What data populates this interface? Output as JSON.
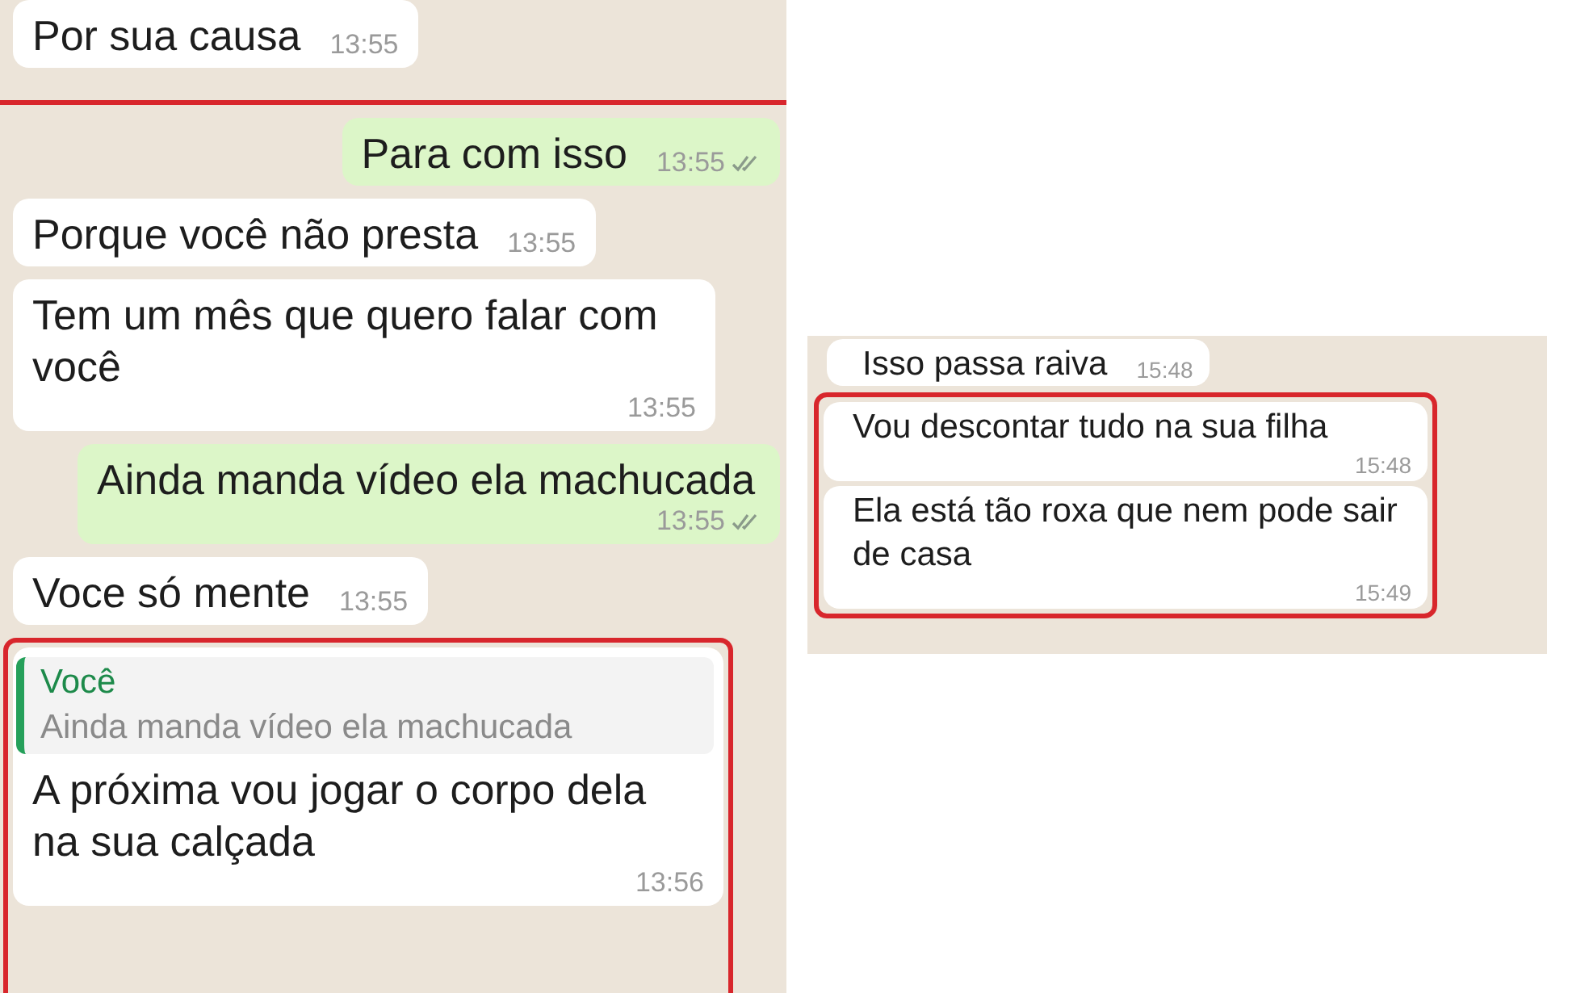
{
  "panels": [
    {
      "items": [
        {
          "kind": "message",
          "mine": false,
          "text": "Por sua causa",
          "time": "13:55"
        },
        {
          "kind": "red_line"
        },
        {
          "kind": "message",
          "mine": true,
          "text": "Para com isso",
          "time": "13:55",
          "double_tick": true
        },
        {
          "kind": "message",
          "mine": false,
          "text": "Porque você não presta",
          "time": "13:55"
        },
        {
          "kind": "message",
          "mine": false,
          "text": "Tem um mês que quero falar com você",
          "time": "13:55"
        },
        {
          "kind": "message",
          "mine": true,
          "text": "Ainda manda vídeo ela machucada",
          "time": "13:55",
          "double_tick": true
        },
        {
          "kind": "message",
          "mine": false,
          "text": "Voce só mente",
          "time": "13:55"
        },
        {
          "kind": "frame",
          "messages": [
            {
              "mine": false,
              "quote": {
                "author": "Você",
                "text": "Ainda manda vídeo ela machucada"
              },
              "text": "A próxima vou jogar o corpo dela na sua calçada",
              "time": "13:56"
            }
          ]
        }
      ]
    },
    {
      "items": [
        {
          "kind": "message",
          "mine": false,
          "text": "Isso passa raiva",
          "time": "15:48"
        },
        {
          "kind": "frame",
          "messages": [
            {
              "mine": false,
              "text": "Vou descontar tudo na sua filha",
              "time": "15:48"
            },
            {
              "mine": false,
              "text": "Ela está tão roxa que nem pode sair de casa",
              "time": "15:49"
            }
          ]
        }
      ]
    }
  ]
}
